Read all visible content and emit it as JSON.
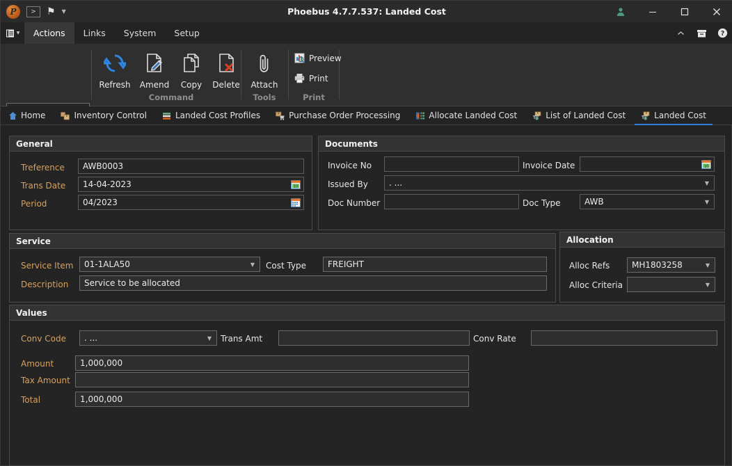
{
  "window": {
    "title": "Phoebus 4.7.7.537: Landed Cost",
    "logo_letter": "P",
    "quick_access": [
      {
        "name": "console-icon",
        "glyph": ">"
      },
      {
        "name": "bookmark-icon",
        "glyph": "⚑"
      },
      {
        "name": "chevron-down-icon",
        "glyph": "▾"
      }
    ],
    "controls": {
      "user": "\u0000",
      "minimize": "—",
      "maximize": "☐",
      "close": "✕"
    }
  },
  "menubar": {
    "app_menu_glyph": "☰",
    "app_menu_caret": "▾",
    "items": [
      {
        "label": "Actions",
        "active": true
      },
      {
        "label": "Links",
        "active": false
      },
      {
        "label": "System",
        "active": false
      },
      {
        "label": "Setup",
        "active": false
      }
    ],
    "right_icons": [
      {
        "name": "collapse-ribbon-icon",
        "glyph": "˄"
      },
      {
        "name": "archive-icon",
        "glyph": "⌸"
      },
      {
        "name": "help-icon",
        "glyph": "?"
      }
    ]
  },
  "ribbon": {
    "search": {
      "value": "",
      "placeholder": "",
      "icon": "search-icon"
    },
    "groups": [
      {
        "name": "Command",
        "label": "Command"
      },
      {
        "name": "Tools",
        "label": "Tools"
      },
      {
        "name": "Print",
        "label": "Print"
      }
    ],
    "buttons": {
      "refresh": "Refresh",
      "amend": "Amend",
      "copy": "Copy",
      "delete": "Delete",
      "attach": "Attach",
      "preview": "Preview",
      "print": "Print"
    }
  },
  "tabs": [
    {
      "label": "Home",
      "icon": "home-icon",
      "active": false
    },
    {
      "label": "Inventory Control",
      "icon": "boxes-icon",
      "active": false
    },
    {
      "label": "Landed Cost Profiles",
      "icon": "profiles-icon",
      "active": false
    },
    {
      "label": "Purchase Order Processing",
      "icon": "cart-box-icon",
      "active": false
    },
    {
      "label": "Allocate Landed Cost",
      "icon": "allocate-icon",
      "active": false
    },
    {
      "label": "List of Landed Cost",
      "icon": "list-cost-icon",
      "active": false
    },
    {
      "label": "Landed Cost",
      "icon": "landed-cost-icon",
      "active": true
    }
  ],
  "general": {
    "title": "General",
    "treference_label": "Treference",
    "treference_value": "AWB0003",
    "trans_date_label": "Trans Date",
    "trans_date_value": "14-04-2023",
    "period_label": "Period",
    "period_value": "04/2023"
  },
  "documents": {
    "title": "Documents",
    "invoice_no_label": "Invoice No",
    "invoice_no_value": "",
    "invoice_date_label": "Invoice Date",
    "invoice_date_value": "",
    "issued_by_label": "Issued By",
    "issued_by_value": ". ...",
    "doc_number_label": "Doc Number",
    "doc_number_value": "",
    "doc_type_label": "Doc Type",
    "doc_type_value": "AWB"
  },
  "service": {
    "title": "Service",
    "service_item_label": "Service Item",
    "service_item_value": "01-1ALA50",
    "cost_type_label": "Cost Type",
    "cost_type_value": "FREIGHT",
    "description_label": "Description",
    "description_value": "Service to be allocated"
  },
  "allocation": {
    "title": "Allocation",
    "alloc_refs_label": "Alloc Refs",
    "alloc_refs_value": "MH1803258",
    "alloc_criteria_label": "Alloc Criteria",
    "alloc_criteria_value": ""
  },
  "values": {
    "title": "Values",
    "conv_code_label": "Conv Code",
    "conv_code_value": ". ...",
    "trans_amt_label": "Trans Amt",
    "trans_amt_value": "",
    "conv_rate_label": "Conv Rate",
    "conv_rate_value": "",
    "amount_label": "Amount",
    "amount_value": "1,000,000",
    "tax_amount_label": "Tax Amount",
    "tax_amount_value": "",
    "total_label": "Total",
    "total_value": "1,000,000"
  },
  "colors": {
    "accent_blue": "#2f80d8",
    "label_orange": "#d9a05b",
    "panel_bg": "#242424",
    "panel_header": "#333333",
    "window_bg": "#232323"
  }
}
